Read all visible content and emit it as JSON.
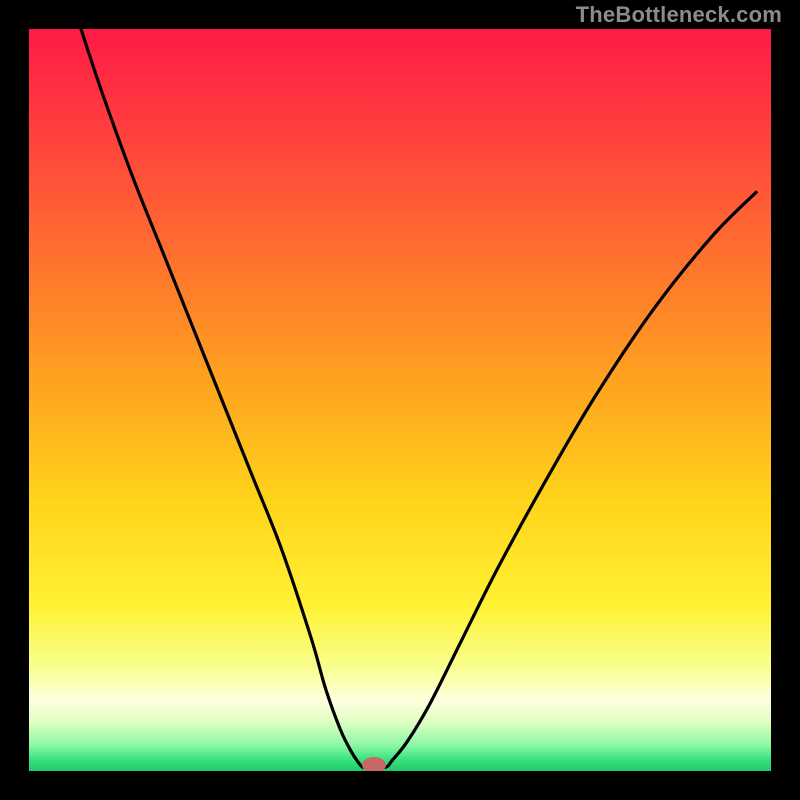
{
  "meta": {
    "watermark": "TheBottleneck.com"
  },
  "chart_data": {
    "type": "line",
    "title": "",
    "xlabel": "",
    "ylabel": "",
    "xlim": [
      0,
      100
    ],
    "ylim": [
      0,
      100
    ],
    "grid": false,
    "legend": false,
    "background_gradient_stops": [
      {
        "offset": 0.0,
        "color": "#ff1a46"
      },
      {
        "offset": 0.12,
        "color": "#ff3a3f"
      },
      {
        "offset": 0.3,
        "color": "#ff6f2f"
      },
      {
        "offset": 0.48,
        "color": "#ffa41f"
      },
      {
        "offset": 0.63,
        "color": "#ffd21a"
      },
      {
        "offset": 0.78,
        "color": "#fff235"
      },
      {
        "offset": 0.86,
        "color": "#f8ff8f"
      },
      {
        "offset": 0.905,
        "color": "#ffffe0"
      },
      {
        "offset": 0.935,
        "color": "#dcffc0"
      },
      {
        "offset": 0.965,
        "color": "#8cf7a5"
      },
      {
        "offset": 0.985,
        "color": "#38e27d"
      },
      {
        "offset": 1.0,
        "color": "#1fc96c"
      }
    ],
    "series": [
      {
        "name": "bottleneck-curve",
        "x": [
          7,
          10,
          14,
          18,
          22,
          26,
          30,
          34,
          38,
          40,
          42,
          43.5,
          44.5,
          45,
          45.5,
          48,
          49,
          51,
          54,
          58,
          63,
          69,
          76,
          84,
          92,
          98
        ],
        "y": [
          100,
          91,
          80,
          70,
          60,
          50,
          40,
          30,
          18,
          11,
          5.5,
          2.5,
          1,
          0.5,
          0.5,
          0.5,
          1.5,
          4,
          9,
          17,
          27,
          38,
          50,
          62,
          72,
          78
        ]
      }
    ],
    "marker": {
      "name": "optimal-point",
      "x": 46.5,
      "y": 0.8,
      "color": "#c56a63",
      "rx": 1.6,
      "ry": 1.1
    }
  }
}
